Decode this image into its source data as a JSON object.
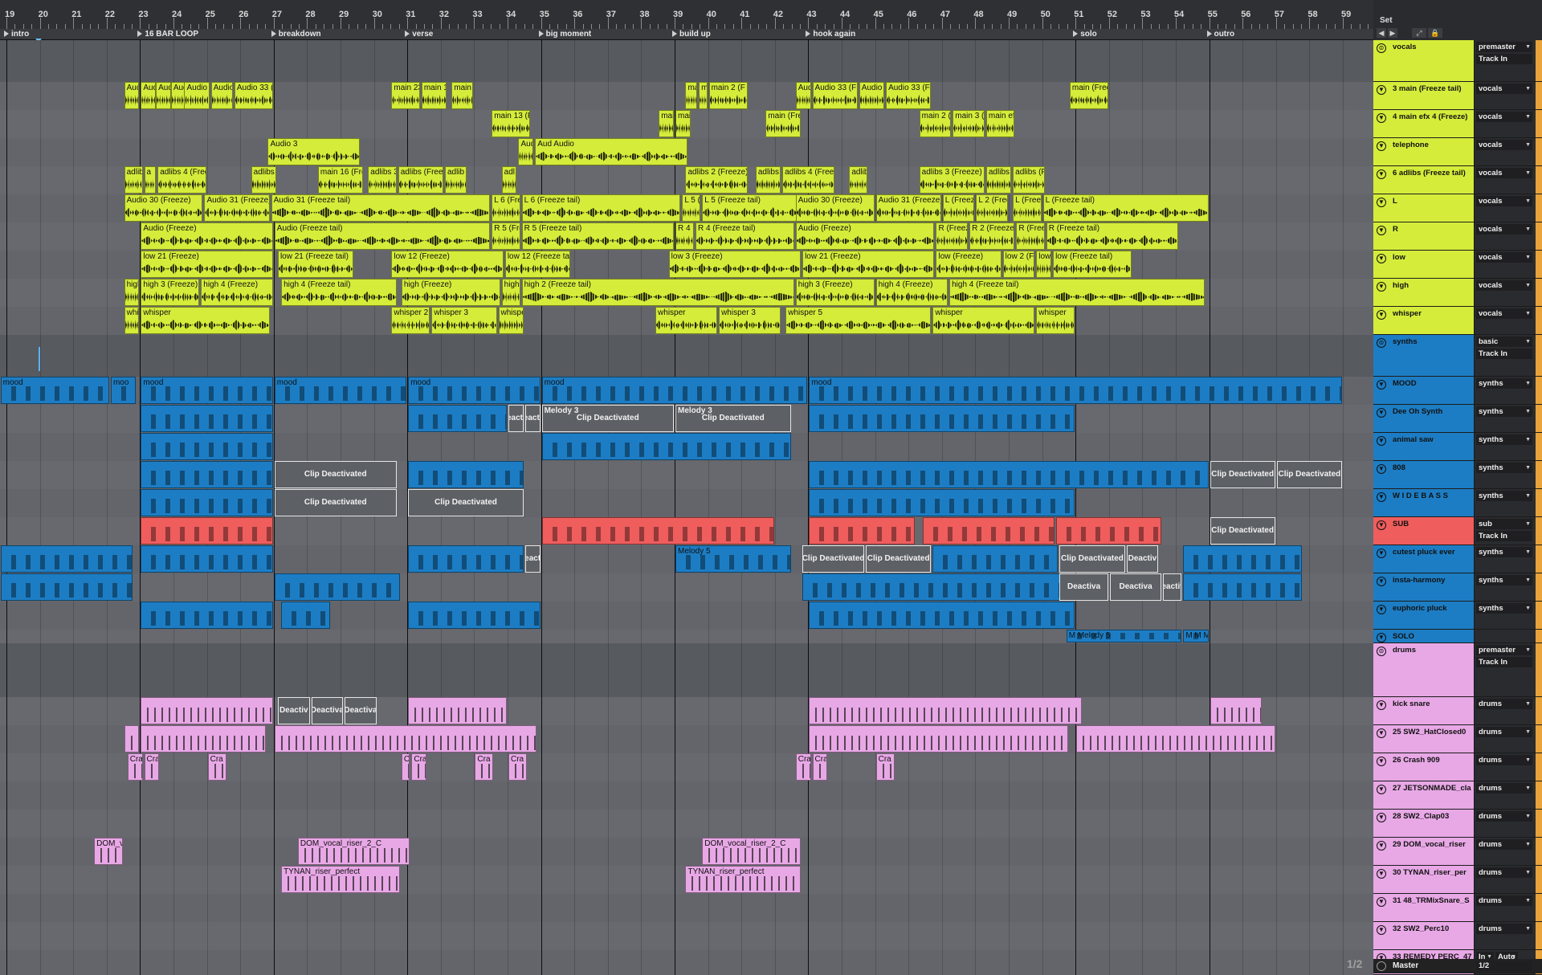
{
  "ruler": {
    "bars": [
      "19",
      "20",
      "21",
      "22",
      "23",
      "24",
      "25",
      "26",
      "27",
      "28",
      "29",
      "30",
      "31",
      "32",
      "33",
      "34",
      "35",
      "36",
      "37",
      "38",
      "39",
      "40",
      "41",
      "42",
      "43",
      "44",
      "45",
      "46",
      "47",
      "48",
      "49",
      "50",
      "51",
      "52",
      "53",
      "54",
      "55",
      "56",
      "57",
      "58",
      "59"
    ]
  },
  "locators": [
    "intro",
    "16 BAR LOOP",
    "breakdown",
    "verse",
    "big moment",
    "build up",
    "hook again",
    "solo",
    "outro"
  ],
  "set_label": "Set",
  "pager": "1/2",
  "colors": {
    "vocals": "#d5ec3a",
    "synths": "#1d7dc4",
    "sub": "#ef5d5d",
    "drums": "#e8a8e6",
    "panel": "#2a2b2e",
    "arrangement": "#63666b"
  },
  "tracks": [
    {
      "name": "vocals",
      "color": "#d5ec3a",
      "group": true,
      "io": "premaster",
      "io2": "Track In",
      "fold": "⊜"
    },
    {
      "name": "3 main (Freeze tail)",
      "color": "#d5ec3a",
      "io": "vocals",
      "fold": "▼"
    },
    {
      "name": "4 main efx 4 (Freeze)",
      "color": "#d5ec3a",
      "io": "vocals",
      "fold": "▼"
    },
    {
      "name": "telephone",
      "color": "#d5ec3a",
      "io": "vocals",
      "fold": "▼"
    },
    {
      "name": "6 adlibs (Freeze tail)",
      "color": "#d5ec3a",
      "io": "vocals",
      "fold": "▼"
    },
    {
      "name": "L",
      "color": "#d5ec3a",
      "io": "vocals",
      "fold": "▼"
    },
    {
      "name": "R",
      "color": "#d5ec3a",
      "io": "vocals",
      "fold": "▼"
    },
    {
      "name": "low",
      "color": "#d5ec3a",
      "io": "vocals",
      "fold": "▼"
    },
    {
      "name": "high",
      "color": "#d5ec3a",
      "io": "vocals",
      "fold": "▼"
    },
    {
      "name": "whisper",
      "color": "#d5ec3a",
      "io": "vocals",
      "fold": "▼"
    },
    {
      "name": "synths",
      "color": "#1d7dc4",
      "group": true,
      "io": "basic",
      "io2": "Track In",
      "fold": "⊜"
    },
    {
      "name": "MOOD",
      "color": "#1d7dc4",
      "io": "synths",
      "fold": "▼"
    },
    {
      "name": "Dee Oh Synth",
      "color": "#1d7dc4",
      "io": "synths",
      "fold": "▼"
    },
    {
      "name": "animal saw",
      "color": "#1d7dc4",
      "io": "synths",
      "fold": "▼"
    },
    {
      "name": "808",
      "color": "#1d7dc4",
      "io": "synths",
      "fold": "▼"
    },
    {
      "name": "W I D E B A S S",
      "color": "#1d7dc4",
      "io": "synths",
      "fold": "▼"
    },
    {
      "name": "SUB",
      "color": "#ef5d5d",
      "io": "sub",
      "io2": "Track In",
      "fold": "▼"
    },
    {
      "name": "cutest pluck ever",
      "color": "#1d7dc4",
      "io": "synths",
      "fold": "▼"
    },
    {
      "name": "insta-harmony",
      "color": "#1d7dc4",
      "io": "synths",
      "fold": "▼"
    },
    {
      "name": "euphoric pluck",
      "color": "#1d7dc4",
      "io": "synths",
      "fold": "▼"
    },
    {
      "name": "SOLO",
      "color": "#1d7dc4",
      "io": "",
      "fold": "▼"
    },
    {
      "name": "drums",
      "color": "#e8a8e6",
      "group": true,
      "io": "premaster",
      "io2": "Track In",
      "fold": "⊜"
    },
    {
      "name": "kick snare",
      "color": "#e8a8e6",
      "io": "drums",
      "fold": "▼"
    },
    {
      "name": "25 SW2_HatClosed0",
      "color": "#e8a8e6",
      "io": "drums",
      "fold": "▼"
    },
    {
      "name": "26 Crash 909",
      "color": "#e8a8e6",
      "io": "drums",
      "fold": "▼"
    },
    {
      "name": "27 JETSONMADE_cla",
      "color": "#e8a8e6",
      "io": "drums",
      "fold": "▼"
    },
    {
      "name": "28 SW2_Clap03",
      "color": "#e8a8e6",
      "io": "drums",
      "fold": "▼"
    },
    {
      "name": "29 DOM_vocal_riser",
      "color": "#e8a8e6",
      "io": "drums",
      "fold": "▼"
    },
    {
      "name": "30 TYNAN_riser_per",
      "color": "#e8a8e6",
      "io": "drums",
      "fold": "▼"
    },
    {
      "name": "31 48_TRMixSnare_S",
      "color": "#e8a8e6",
      "io": "drums",
      "fold": "▼"
    },
    {
      "name": "32 SW2_Perc10",
      "color": "#e8a8e6",
      "io": "drums",
      "fold": "▼"
    },
    {
      "name": "33 REMEDY PERC_47",
      "color": "#e8a8e6",
      "io": "In",
      "io_extra": "Auto",
      "fold": "▼"
    }
  ],
  "master": {
    "name": "Master",
    "io": "1/2"
  },
  "clips": [
    {
      "lane": 1,
      "name": "Aud",
      "kind": "y"
    },
    {
      "lane": 1,
      "name": "Aud",
      "kind": "y"
    },
    {
      "lane": 1,
      "name": "Aud",
      "kind": "y"
    },
    {
      "lane": 1,
      "name": "Aud",
      "kind": "y"
    },
    {
      "lane": 1,
      "name": "Audio",
      "kind": "y"
    },
    {
      "lane": 1,
      "name": "Audio 2",
      "kind": "y"
    },
    {
      "lane": 1,
      "name": "Audio 33 (Fre",
      "kind": "y"
    },
    {
      "lane": 1,
      "name": "main 23 (Fr",
      "kind": "y"
    },
    {
      "lane": 1,
      "name": "main 13",
      "kind": "y"
    },
    {
      "lane": 1,
      "name": "main 14",
      "kind": "y"
    },
    {
      "lane": 1,
      "name": "main",
      "kind": "y"
    },
    {
      "lane": 1,
      "name": "ma",
      "kind": "y"
    },
    {
      "lane": 1,
      "name": "main 2 (F",
      "kind": "y"
    },
    {
      "lane": 1,
      "name": "Aud",
      "kind": "y"
    },
    {
      "lane": 1,
      "name": "Audio 33 (F",
      "kind": "y"
    },
    {
      "lane": 1,
      "name": "Audio 2",
      "kind": "y"
    },
    {
      "lane": 1,
      "name": "Audio 33 (Fr",
      "kind": "y"
    },
    {
      "lane": 1,
      "name": "main (Freez",
      "kind": "y"
    },
    {
      "lane": 2,
      "name": "main 13 (F",
      "kind": "y"
    },
    {
      "lane": 2,
      "name": "main",
      "kind": "y"
    },
    {
      "lane": 2,
      "name": "mai",
      "kind": "y"
    },
    {
      "lane": 2,
      "name": "main (Fre",
      "kind": "y"
    },
    {
      "lane": 2,
      "name": "main 2 (F",
      "kind": "y"
    },
    {
      "lane": 2,
      "name": "main 3 (F",
      "kind": "y"
    },
    {
      "lane": 2,
      "name": "main efx",
      "kind": "y"
    },
    {
      "lane": 3,
      "name": "Audio 3",
      "kind": "y"
    },
    {
      "lane": 3,
      "name": "Aud",
      "kind": "y"
    },
    {
      "lane": 3,
      "name": "Aud Audio",
      "kind": "y"
    },
    {
      "lane": 4,
      "name": "adlibs",
      "kind": "y"
    },
    {
      "lane": 4,
      "name": "a",
      "kind": "y"
    },
    {
      "lane": 4,
      "name": "adlibs 4 (Free",
      "kind": "y"
    },
    {
      "lane": 4,
      "name": "adlibs",
      "kind": "y"
    },
    {
      "lane": 4,
      "name": "main 16 (Fre",
      "kind": "y"
    },
    {
      "lane": 4,
      "name": "adlibs 3",
      "kind": "y"
    },
    {
      "lane": 4,
      "name": "adlibs (Free",
      "kind": "y"
    },
    {
      "lane": 4,
      "name": "adlib",
      "kind": "y"
    },
    {
      "lane": 4,
      "name": "adl",
      "kind": "y"
    },
    {
      "lane": 4,
      "name": "adlibs 2 (Freeze)",
      "kind": "y"
    },
    {
      "lane": 4,
      "name": "adlibs",
      "kind": "y"
    },
    {
      "lane": 4,
      "name": "adlibs 4 (Freeze)",
      "kind": "y"
    },
    {
      "lane": 4,
      "name": "adlibi",
      "kind": "y"
    },
    {
      "lane": 4,
      "name": "adlibs 3 (Freeze)",
      "kind": "y"
    },
    {
      "lane": 4,
      "name": "adlibs 4",
      "kind": "y"
    },
    {
      "lane": 4,
      "name": "adlibs (F",
      "kind": "y"
    },
    {
      "lane": 5,
      "name": "Audio 30 (Freeze)",
      "kind": "y"
    },
    {
      "lane": 5,
      "name": "Audio 31 (Freeze)",
      "kind": "y"
    },
    {
      "lane": 5,
      "name": "Audio 31 (Freeze tail)",
      "kind": "y"
    },
    {
      "lane": 5,
      "name": "L 6 (Freeze tail)",
      "kind": "y"
    },
    {
      "lane": 5,
      "name": "L 6 (Freeze tail)",
      "kind": "y"
    },
    {
      "lane": 5,
      "name": "L 5 (Freeze)",
      "kind": "y"
    },
    {
      "lane": 5,
      "name": "L 5 (Freeze tail)",
      "kind": "y"
    },
    {
      "lane": 5,
      "name": "Audio 30 (Freeze)",
      "kind": "y"
    },
    {
      "lane": 5,
      "name": "Audio 31 (Freeze)",
      "kind": "y"
    },
    {
      "lane": 5,
      "name": "L (Freeze)",
      "kind": "y"
    },
    {
      "lane": 5,
      "name": "L 2 (Freeze)",
      "kind": "y"
    },
    {
      "lane": 5,
      "name": "L (Freeze)",
      "kind": "y"
    },
    {
      "lane": 5,
      "name": "L (Freeze tail)",
      "kind": "y"
    },
    {
      "lane": 6,
      "name": "Audio (Freeze)",
      "kind": "y"
    },
    {
      "lane": 6,
      "name": "Audio (Freeze tail)",
      "kind": "y"
    },
    {
      "lane": 6,
      "name": "R 5 (Freeze)",
      "kind": "y"
    },
    {
      "lane": 6,
      "name": "R 5 (Freeze tail)",
      "kind": "y"
    },
    {
      "lane": 6,
      "name": "R 4 (Freeze)",
      "kind": "y"
    },
    {
      "lane": 6,
      "name": "R 4 (Freeze tail)",
      "kind": "y"
    },
    {
      "lane": 6,
      "name": "Audio (Freeze)",
      "kind": "y"
    },
    {
      "lane": 6,
      "name": "R (Freeze)",
      "kind": "y"
    },
    {
      "lane": 6,
      "name": "R 2 (Freeze)",
      "kind": "y"
    },
    {
      "lane": 6,
      "name": "R (Freeze)",
      "kind": "y"
    },
    {
      "lane": 6,
      "name": "R (Freeze tail)",
      "kind": "y"
    },
    {
      "lane": 7,
      "name": "low 21 (Freeze)",
      "kind": "y"
    },
    {
      "lane": 7,
      "name": "low 21 (Freeze tail)",
      "kind": "y"
    },
    {
      "lane": 7,
      "name": "low 12 (Freeze)",
      "kind": "y"
    },
    {
      "lane": 7,
      "name": "low 12 (Freeze tail)",
      "kind": "y"
    },
    {
      "lane": 7,
      "name": "low 3 (Freeze)",
      "kind": "y"
    },
    {
      "lane": 7,
      "name": "low 21 (Freeze)",
      "kind": "y"
    },
    {
      "lane": 7,
      "name": "low (Freeze)",
      "kind": "y"
    },
    {
      "lane": 7,
      "name": "low 2 (Freeze)",
      "kind": "y"
    },
    {
      "lane": 7,
      "name": "low (Freeze)",
      "kind": "y"
    },
    {
      "lane": 7,
      "name": "low (Freeze tail)",
      "kind": "y"
    },
    {
      "lane": 8,
      "name": "high",
      "kind": "y"
    },
    {
      "lane": 8,
      "name": "high 3 (Freeze)",
      "kind": "y"
    },
    {
      "lane": 8,
      "name": "high 4 (Freeze)",
      "kind": "y"
    },
    {
      "lane": 8,
      "name": "high 4 (Freeze tail)",
      "kind": "y"
    },
    {
      "lane": 8,
      "name": "high (Freeze)",
      "kind": "y"
    },
    {
      "lane": 8,
      "name": "high",
      "kind": "y"
    },
    {
      "lane": 8,
      "name": "high 2 (Freeze tail)",
      "kind": "y"
    },
    {
      "lane": 8,
      "name": "high 3 (Freeze)",
      "kind": "y"
    },
    {
      "lane": 8,
      "name": "high 4 (Freeze)",
      "kind": "y"
    },
    {
      "lane": 8,
      "name": "high 4 (Freeze tail)",
      "kind": "y"
    },
    {
      "lane": 9,
      "name": "whi",
      "kind": "y"
    },
    {
      "lane": 9,
      "name": "whisper",
      "kind": "y"
    },
    {
      "lane": 9,
      "name": "whisper 2",
      "kind": "y"
    },
    {
      "lane": 9,
      "name": "whisper 3",
      "kind": "y"
    },
    {
      "lane": 9,
      "name": "whisper",
      "kind": "y"
    },
    {
      "lane": 9,
      "name": "whisper",
      "kind": "y"
    },
    {
      "lane": 9,
      "name": "whisper 3",
      "kind": "y"
    },
    {
      "lane": 9,
      "name": "whisper 5",
      "kind": "y"
    },
    {
      "lane": 9,
      "name": "whisper",
      "kind": "y"
    },
    {
      "lane": 9,
      "name": "whisper",
      "kind": "y"
    },
    {
      "lane": 9,
      "name": "whisper 2",
      "kind": "y"
    },
    {
      "lane": 11,
      "name": "mood",
      "kind": "b"
    },
    {
      "lane": 11,
      "name": "moo",
      "kind": "b"
    },
    {
      "lane": 11,
      "name": "mood",
      "kind": "b"
    },
    {
      "lane": 11,
      "name": "mood",
      "kind": "b"
    },
    {
      "lane": 11,
      "name": "mood",
      "kind": "b"
    },
    {
      "lane": 11,
      "name": "mood",
      "kind": "b"
    },
    {
      "lane": 11,
      "name": "mood",
      "kind": "b"
    },
    {
      "lane": 12,
      "name": "",
      "kind": "b"
    },
    {
      "lane": 12,
      "name": "",
      "kind": "b"
    },
    {
      "lane": 12,
      "name": "eacti",
      "kind": "d"
    },
    {
      "lane": 12,
      "name": "eacti",
      "kind": "d"
    },
    {
      "lane": 12,
      "name": "Clip Deactivated",
      "kind": "d",
      "sub": "Melody 3"
    },
    {
      "lane": 12,
      "name": "Clip Deactivated",
      "kind": "d",
      "sub": "Melody 3"
    },
    {
      "lane": 12,
      "name": "",
      "kind": "b"
    },
    {
      "lane": 13,
      "name": "",
      "kind": "b"
    },
    {
      "lane": 13,
      "name": "",
      "kind": "b"
    },
    {
      "lane": 14,
      "name": "",
      "kind": "b"
    },
    {
      "lane": 14,
      "name": "Clip Deactivated",
      "kind": "d"
    },
    {
      "lane": 14,
      "name": "",
      "kind": "b"
    },
    {
      "lane": 14,
      "name": "",
      "kind": "b"
    },
    {
      "lane": 14,
      "name": "Clip Deactivated",
      "kind": "d"
    },
    {
      "lane": 14,
      "name": "Clip Deactivated",
      "kind": "d"
    },
    {
      "lane": 15,
      "name": "",
      "kind": "b"
    },
    {
      "lane": 15,
      "name": "Clip Deactivated",
      "kind": "d"
    },
    {
      "lane": 15,
      "name": "Clip Deactivated",
      "kind": "d"
    },
    {
      "lane": 15,
      "name": "",
      "kind": "b"
    },
    {
      "lane": 16,
      "name": "",
      "kind": "r"
    },
    {
      "lane": 16,
      "name": "",
      "kind": "r"
    },
    {
      "lane": 16,
      "name": "",
      "kind": "r"
    },
    {
      "lane": 16,
      "name": "",
      "kind": "r"
    },
    {
      "lane": 16,
      "name": "",
      "kind": "r"
    },
    {
      "lane": 16,
      "name": "Clip Deactivated",
      "kind": "d"
    },
    {
      "lane": 17,
      "name": "",
      "kind": "b"
    },
    {
      "lane": 17,
      "name": "",
      "kind": "b"
    },
    {
      "lane": 17,
      "name": "",
      "kind": "b"
    },
    {
      "lane": 17,
      "name": "eact",
      "kind": "d"
    },
    {
      "lane": 17,
      "name": "Melody 5",
      "kind": "b"
    },
    {
      "lane": 17,
      "name": "Clip Deactivated",
      "kind": "d"
    },
    {
      "lane": 17,
      "name": "Clip Deactivated",
      "kind": "d"
    },
    {
      "lane": 17,
      "name": "",
      "kind": "b"
    },
    {
      "lane": 17,
      "name": "Clip Deactivated",
      "kind": "d"
    },
    {
      "lane": 17,
      "name": "Deactiv",
      "kind": "d"
    },
    {
      "lane": 17,
      "name": "",
      "kind": "b"
    },
    {
      "lane": 18,
      "name": "",
      "kind": "b"
    },
    {
      "lane": 18,
      "name": "",
      "kind": "b"
    },
    {
      "lane": 18,
      "name": "",
      "kind": "b"
    },
    {
      "lane": 18,
      "name": "Deactiva",
      "kind": "d"
    },
    {
      "lane": 18,
      "name": "Deactiva",
      "kind": "d"
    },
    {
      "lane": 18,
      "name": "Deactiva",
      "kind": "d"
    },
    {
      "lane": 18,
      "name": "",
      "kind": "b"
    },
    {
      "lane": 19,
      "name": "",
      "kind": "b"
    },
    {
      "lane": 19,
      "name": "",
      "kind": "b"
    },
    {
      "lane": 19,
      "name": "",
      "kind": "b"
    },
    {
      "lane": 19,
      "name": "",
      "kind": "b"
    },
    {
      "lane": 20,
      "name": "M Melody 5",
      "kind": "b"
    },
    {
      "lane": 20,
      "name": "M M Me",
      "kind": "b"
    },
    {
      "lane": 22,
      "name": "",
      "kind": "p"
    },
    {
      "lane": 22,
      "name": "Deactiv",
      "kind": "d"
    },
    {
      "lane": 22,
      "name": "Deactiva",
      "kind": "d"
    },
    {
      "lane": 22,
      "name": "Deactiva",
      "kind": "d"
    },
    {
      "lane": 22,
      "name": "",
      "kind": "p"
    },
    {
      "lane": 22,
      "name": "",
      "kind": "p"
    },
    {
      "lane": 22,
      "name": "",
      "kind": "p"
    },
    {
      "lane": 23,
      "name": "",
      "kind": "p"
    },
    {
      "lane": 23,
      "name": "",
      "kind": "p"
    },
    {
      "lane": 23,
      "name": "",
      "kind": "p"
    },
    {
      "lane": 23,
      "name": "",
      "kind": "p"
    },
    {
      "lane": 23,
      "name": "",
      "kind": "p"
    },
    {
      "lane": 24,
      "name": "Cra",
      "kind": "p"
    },
    {
      "lane": 24,
      "name": "Cra",
      "kind": "p"
    },
    {
      "lane": 24,
      "name": "Cra",
      "kind": "p"
    },
    {
      "lane": 24,
      "name": "Cra",
      "kind": "p"
    },
    {
      "lane": 24,
      "name": "Cra",
      "kind": "p"
    },
    {
      "lane": 24,
      "name": "Cra",
      "kind": "p"
    },
    {
      "lane": 24,
      "name": "Cra",
      "kind": "p"
    },
    {
      "lane": 24,
      "name": "Cra",
      "kind": "p"
    },
    {
      "lane": 24,
      "name": "Cra",
      "kind": "p"
    },
    {
      "lane": 24,
      "name": "Cra",
      "kind": "p"
    },
    {
      "lane": 27,
      "name": "DOM_vo",
      "kind": "p"
    },
    {
      "lane": 27,
      "name": "DOM_vocal_riser_2_C",
      "kind": "p"
    },
    {
      "lane": 27,
      "name": "DOM_vocal_riser_2_C",
      "kind": "p"
    },
    {
      "lane": 28,
      "name": "TYNAN_riser_perfect",
      "kind": "p"
    },
    {
      "lane": 28,
      "name": "TYNAN_riser_perfect",
      "kind": "p"
    }
  ]
}
